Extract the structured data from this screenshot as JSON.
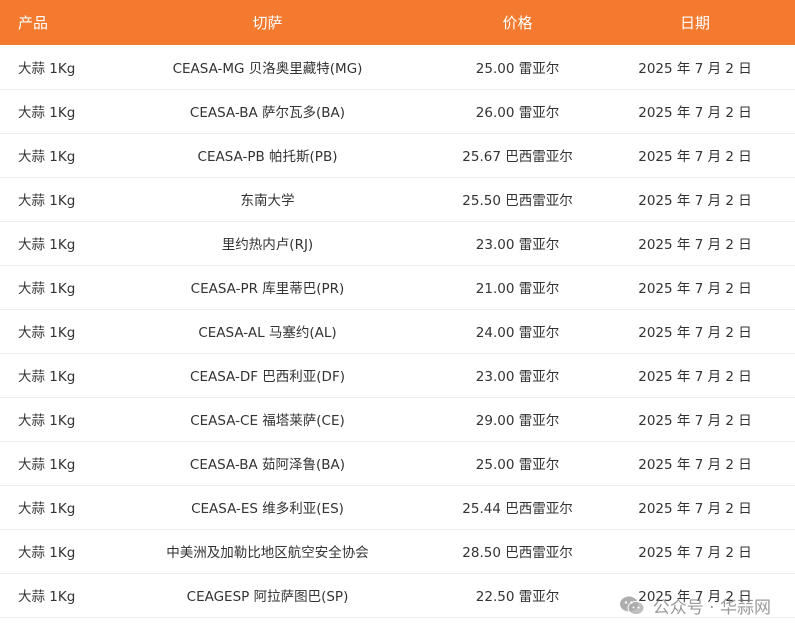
{
  "headers": {
    "product": "产品",
    "market": "切萨",
    "price": "价格",
    "date": "日期"
  },
  "rows": [
    {
      "product": "大蒜 1Kg",
      "market": "CEASA-MG 贝洛奥里藏特(MG)",
      "price": "25.00 雷亚尔",
      "date": "2025 年 7 月 2 日"
    },
    {
      "product": "大蒜 1Kg",
      "market": "CEASA-BA 萨尔瓦多(BA)",
      "price": "26.00 雷亚尔",
      "date": "2025 年 7 月 2 日"
    },
    {
      "product": "大蒜 1Kg",
      "market": "CEASA-PB 帕托斯(PB)",
      "price": "25.67 巴西雷亚尔",
      "date": "2025 年 7 月 2 日"
    },
    {
      "product": "大蒜 1Kg",
      "market": "东南大学",
      "price": "25.50 巴西雷亚尔",
      "date": "2025 年 7 月 2 日"
    },
    {
      "product": "大蒜 1Kg",
      "market": "里约热内卢(RJ)",
      "price": "23.00 雷亚尔",
      "date": "2025 年 7 月 2 日"
    },
    {
      "product": "大蒜 1Kg",
      "market": "CEASA-PR 库里蒂巴(PR)",
      "price": "21.00 雷亚尔",
      "date": "2025 年 7 月 2 日"
    },
    {
      "product": "大蒜 1Kg",
      "market": "CEASA-AL 马塞约(AL)",
      "price": "24.00 雷亚尔",
      "date": "2025 年 7 月 2 日"
    },
    {
      "product": "大蒜 1Kg",
      "market": "CEASA-DF 巴西利亚(DF)",
      "price": "23.00 雷亚尔",
      "date": "2025 年 7 月 2 日"
    },
    {
      "product": "大蒜 1Kg",
      "market": "CEASA-CE 福塔莱萨(CE)",
      "price": "29.00 雷亚尔",
      "date": "2025 年 7 月 2 日"
    },
    {
      "product": "大蒜 1Kg",
      "market": "CEASA-BA 茹阿泽鲁(BA)",
      "price": "25.00 雷亚尔",
      "date": "2025 年 7 月 2 日"
    },
    {
      "product": "大蒜 1Kg",
      "market": "CEASA-ES 维多利亚(ES)",
      "price": "25.44 巴西雷亚尔",
      "date": "2025 年 7 月 2 日"
    },
    {
      "product": "大蒜 1Kg",
      "market": "中美洲及加勒比地区航空安全协会",
      "price": "28.50 巴西雷亚尔",
      "date": "2025 年 7 月 2 日"
    },
    {
      "product": "大蒜 1Kg",
      "market": "CEAGESP 阿拉萨图巴(SP)",
      "price": "22.50 雷亚尔",
      "date": "2025 年 7 月 2 日"
    }
  ],
  "watermark": {
    "text": "公众号 · 华蒜网",
    "icon": "wechat-icon"
  },
  "colors": {
    "header_bg": "#f47a2f",
    "header_text": "#ffffff",
    "row_divider": "#ebebeb"
  }
}
